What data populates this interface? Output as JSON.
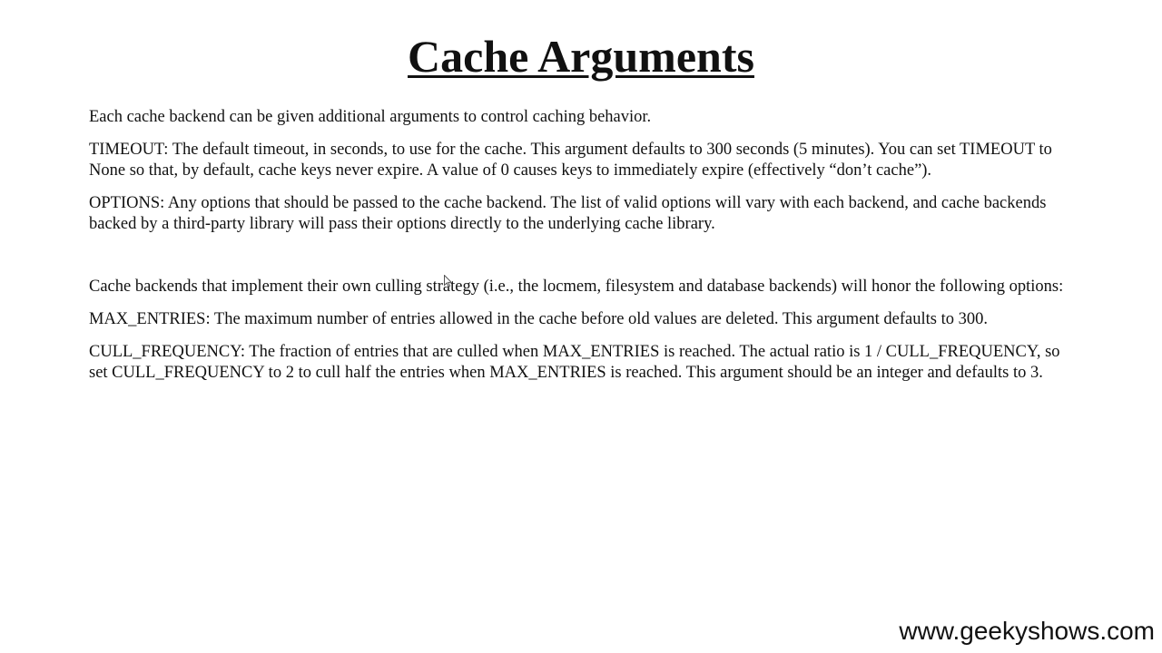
{
  "title": "Cache Arguments",
  "paragraphs": [
    "Each cache backend can be given additional arguments to control caching behavior.",
    "TIMEOUT: The default timeout, in seconds, to use for the cache. This argument defaults to 300 seconds (5 minutes). You can set TIMEOUT to None so that, by default, cache keys never expire. A value of 0 causes keys to immediately expire (effectively “don’t cache”).",
    "OPTIONS: Any options that should be passed to the cache backend. The list of valid options will vary with each backend, and cache backends backed by a third-party library will pass their options directly to the underlying cache library.",
    "Cache backends that implement their own culling strategy (i.e., the locmem, filesystem and database backends) will honor the following options:",
    "MAX_ENTRIES: The maximum number of entries allowed in the cache before old values are deleted. This argument defaults to 300.",
    "CULL_FREQUENCY: The fraction of entries that are culled when MAX_ENTRIES is reached. The actual ratio is 1 / CULL_FREQUENCY, so set CULL_FREQUENCY to 2 to cull half the entries when MAX_ENTRIES is reached. This argument should be an integer and defaults to 3."
  ],
  "watermark": "www.geekyshows.com",
  "cursor_icon": "mouse-pointer-icon"
}
